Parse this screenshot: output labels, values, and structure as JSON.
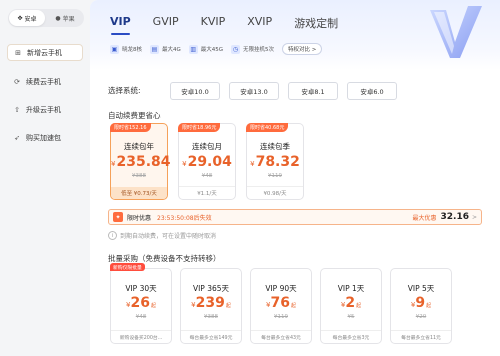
{
  "sidebar": {
    "os_options": [
      "安卓",
      "苹果"
    ],
    "items": [
      {
        "label": "新增云手机",
        "icon": "add-phone-icon"
      },
      {
        "label": "续费云手机",
        "icon": "refresh-icon"
      },
      {
        "label": "升级云手机",
        "icon": "upgrade-icon"
      },
      {
        "label": "购买加速包",
        "icon": "rocket-icon"
      }
    ]
  },
  "header": {
    "tabs": [
      "VIP",
      "GVIP",
      "KVIP",
      "XVIP",
      "游戏定制"
    ],
    "features": [
      "晓龙8核",
      "最大4G",
      "最大45G",
      "无限挂机5次"
    ],
    "compare_label": "特权对比 >"
  },
  "system": {
    "label": "选择系统:",
    "options": [
      "安卓10.0",
      "安卓13.0",
      "安卓8.1",
      "安卓6.0"
    ]
  },
  "autorenew": {
    "title": "自动续费更省心",
    "packages": [
      {
        "badge": "限时省152.16",
        "name": "连续包年",
        "currency": "¥",
        "price": "235.84",
        "orig": "¥388",
        "foot": "低至 ¥0.73/天"
      },
      {
        "badge": "限时省18.96元",
        "name": "连续包月",
        "currency": "¥",
        "price": "29.04",
        "orig": "¥48",
        "foot": "¥1.1/天"
      },
      {
        "badge": "限时省40.68元",
        "name": "连续包季",
        "currency": "¥",
        "price": "78.32",
        "orig": "¥119",
        "foot": "¥0.98/天"
      }
    ]
  },
  "promo": {
    "title": "限时优惠",
    "timer": "23:53:50:08后失效",
    "right_label": "最大优惠",
    "amount": "32.16",
    "chevron": ">"
  },
  "note": "到期自动续费，可在设置中随时取消",
  "bulk": {
    "title": "批量采购（免费设备不支持转移）",
    "packages": [
      {
        "badge": "新购仅限批量",
        "name": "VIP 30天",
        "currency": "¥",
        "price": "26",
        "unit": "起",
        "orig": "¥48",
        "foot": "新购设备买200台..."
      },
      {
        "badge": "",
        "name": "VIP 365天",
        "currency": "¥",
        "price": "239",
        "unit": "起",
        "orig": "¥388",
        "foot": "每台最多立省149元"
      },
      {
        "badge": "",
        "name": "VIP 90天",
        "currency": "¥",
        "price": "76",
        "unit": "起",
        "orig": "¥119",
        "foot": "每台最多立省43元"
      },
      {
        "badge": "",
        "name": "VIP 1天",
        "currency": "¥",
        "price": "2",
        "unit": "起",
        "orig": "¥5",
        "foot": "每台最多立省3元"
      },
      {
        "badge": "",
        "name": "VIP 5天",
        "currency": "¥",
        "price": "9",
        "unit": "起",
        "orig": "¥20",
        "foot": "每台最多立省11元"
      }
    ]
  },
  "colors": {
    "accent": "#e8622a",
    "badge": "#ff6b3d",
    "vip_blue": "#2b4cc4"
  }
}
